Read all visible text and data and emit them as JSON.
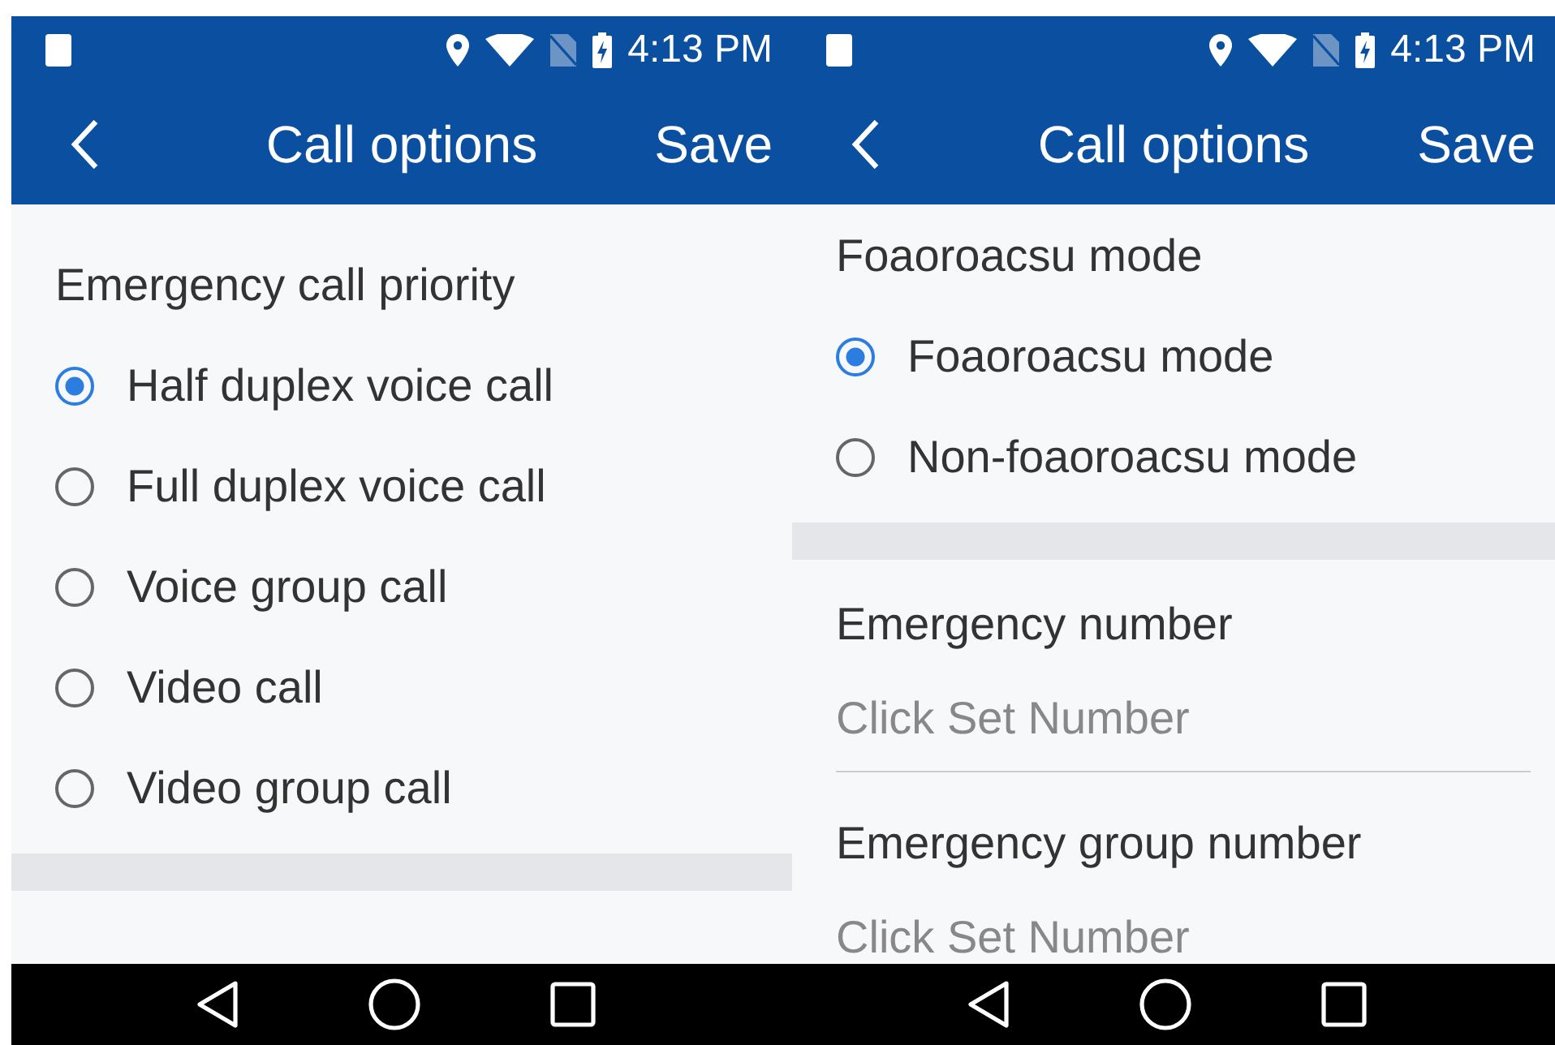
{
  "screens": [
    {
      "status_bar": {
        "time": "4:13 PM"
      },
      "toolbar": {
        "title": "Call options",
        "action": "Save"
      },
      "scrolled": false,
      "sections": [
        {
          "kind": "radio_group",
          "title": "Emergency call priority",
          "options": [
            {
              "label": "Half duplex voice call",
              "selected": true
            },
            {
              "label": "Full duplex voice call",
              "selected": false
            },
            {
              "label": "Voice group call",
              "selected": false
            },
            {
              "label": "Video call",
              "selected": false
            },
            {
              "label": "Video group call",
              "selected": false
            }
          ]
        },
        {
          "kind": "divider"
        }
      ]
    },
    {
      "status_bar": {
        "time": "4:13 PM"
      },
      "toolbar": {
        "title": "Call options",
        "action": "Save"
      },
      "scrolled": true,
      "sections": [
        {
          "kind": "radio_group",
          "title": "Foaoroacsu mode",
          "options": [
            {
              "label": "Foaoroacsu mode",
              "selected": true
            },
            {
              "label": "Non-foaoroacsu mode",
              "selected": false
            }
          ]
        },
        {
          "kind": "divider"
        },
        {
          "kind": "number_field",
          "label": "Emergency number",
          "placeholder": "Click Set Number"
        },
        {
          "kind": "number_field",
          "label": "Emergency group number",
          "placeholder": "Click Set Number"
        }
      ]
    }
  ]
}
